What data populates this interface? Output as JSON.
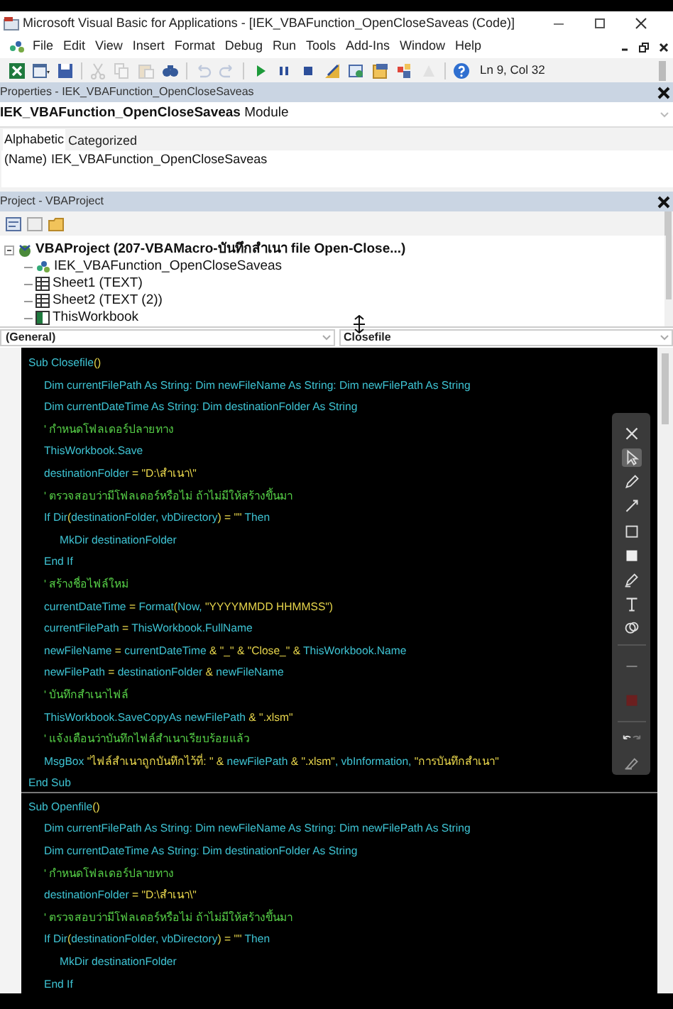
{
  "window": {
    "title": "Microsoft Visual Basic for Applications - [IEK_VBAFunction_OpenCloseSaveas (Code)]"
  },
  "menu": [
    "File",
    "Edit",
    "View",
    "Insert",
    "Format",
    "Debug",
    "Run",
    "Tools",
    "Add-Ins",
    "Window",
    "Help"
  ],
  "toolbar": {
    "buttons": [
      {
        "kind": "excel",
        "disabled": false
      },
      {
        "kind": "insert_form",
        "disabled": false
      },
      {
        "kind": "save",
        "disabled": false
      },
      {
        "kind": "cut",
        "disabled": true
      },
      {
        "kind": "copy",
        "disabled": true
      },
      {
        "kind": "paste",
        "disabled": true
      },
      {
        "kind": "find",
        "disabled": false
      },
      {
        "kind": "undo",
        "disabled": true
      },
      {
        "kind": "redo",
        "disabled": true
      },
      {
        "kind": "run",
        "disabled": false
      },
      {
        "kind": "break",
        "disabled": false
      },
      {
        "kind": "reset",
        "disabled": false
      },
      {
        "kind": "design",
        "disabled": false
      },
      {
        "kind": "project",
        "disabled": false
      },
      {
        "kind": "properties",
        "disabled": false
      },
      {
        "kind": "browser",
        "disabled": false
      },
      {
        "kind": "toolbox",
        "disabled": true
      },
      {
        "kind": "help",
        "disabled": false
      }
    ],
    "position": "Ln 9, Col 32"
  },
  "properties": {
    "title": "Properties - IEK_VBAFunction_OpenCloseSaveas",
    "object": {
      "name": "IEK_VBAFunction_OpenCloseSaveas",
      "type": "Module"
    },
    "tabs": [
      {
        "label": "Alphabetic",
        "selected": true
      },
      {
        "label": "Categorized",
        "selected": false
      }
    ],
    "rows": [
      {
        "name": "(Name)",
        "value": "IEK_VBAFunction_OpenCloseSaveas"
      }
    ]
  },
  "project": {
    "title": "Project - VBAProject",
    "tree": [
      {
        "label": "VBAProject (207-VBAMacro-บันทึกสำเนา file Open-Close...)",
        "kind": "project",
        "expanded": true,
        "children": [
          {
            "label": "IEK_VBAFunction_OpenCloseSaveas",
            "kind": "module"
          },
          {
            "label": "Sheet1 (TEXT)",
            "kind": "sheet"
          },
          {
            "label": "Sheet2 (TEXT (2))",
            "kind": "sheet"
          },
          {
            "label": "ThisWorkbook",
            "kind": "workbook"
          }
        ]
      }
    ]
  },
  "code": {
    "object": "(General)",
    "procedure": "Closefile",
    "procedures": [
      {
        "header": [
          {
            "kind": "code",
            "text": "Sub Closefile"
          },
          {
            "kind": "op",
            "text": "()"
          }
        ],
        "body": [
          {
            "segments": [
              {
                "kind": "code",
                "text": "Dim currentFilePath As String: Dim newFileName As String: Dim newFilePath As String"
              }
            ]
          },
          {
            "segments": [
              {
                "kind": "code",
                "text": "Dim currentDateTime As String: Dim destinationFolder As String"
              }
            ]
          },
          {
            "segments": [
              {
                "kind": "comment",
                "text": "' กำหนดโฟลเดอร์ปลายทาง"
              }
            ]
          },
          {
            "segments": [
              {
                "kind": "code",
                "text": "ThisWorkbook.Save"
              }
            ]
          },
          {
            "segments": [
              {
                "kind": "code",
                "text": "destinationFolder "
              },
              {
                "kind": "op",
                "text": "= "
              },
              {
                "kind": "str",
                "text": "\"D:\\สำเนา\\\""
              }
            ]
          },
          {
            "segments": [
              {
                "kind": "comment",
                "text": "' ตรวจสอบว่ามีโฟลเดอร์หรือไม่ ถ้าไม่มีให้สร้างขึ้นมา"
              }
            ]
          },
          {
            "segments": [
              {
                "kind": "code",
                "text": "If Dir"
              },
              {
                "kind": "op",
                "text": "("
              },
              {
                "kind": "code",
                "text": "destinationFolder, vbDirectory"
              },
              {
                "kind": "op",
                "text": ") = \"\" "
              },
              {
                "kind": "code",
                "text": "Then"
              }
            ],
            "children": [
              {
                "segments": [
                  {
                    "kind": "code",
                    "text": "MkDir destinationFolder"
                  }
                ]
              }
            ]
          },
          {
            "segments": [
              {
                "kind": "code",
                "text": "End If"
              }
            ]
          },
          {
            "segments": [
              {
                "kind": "comment",
                "text": "' สร้างชื่อไฟล์ใหม่"
              }
            ]
          },
          {
            "segments": [
              {
                "kind": "code",
                "text": "currentDateTime "
              },
              {
                "kind": "op",
                "text": "= "
              },
              {
                "kind": "code",
                "text": "Format"
              },
              {
                "kind": "op",
                "text": "("
              },
              {
                "kind": "code",
                "text": "Now, "
              },
              {
                "kind": "str",
                "text": "\"YYYYMMDD HHMMSS\""
              },
              {
                "kind": "op",
                "text": ")"
              }
            ]
          },
          {
            "segments": [
              {
                "kind": "code",
                "text": "currentFilePath "
              },
              {
                "kind": "op",
                "text": "= "
              },
              {
                "kind": "code",
                "text": "ThisWorkbook.FullName"
              }
            ]
          },
          {
            "segments": [
              {
                "kind": "code",
                "text": "newFileName "
              },
              {
                "kind": "op",
                "text": "= "
              },
              {
                "kind": "code",
                "text": "currentDateTime "
              },
              {
                "kind": "op",
                "text": "& "
              },
              {
                "kind": "str",
                "text": "\"_\" "
              },
              {
                "kind": "op",
                "text": "& "
              },
              {
                "kind": "str",
                "text": "\"Close_\" "
              },
              {
                "kind": "op",
                "text": "& "
              },
              {
                "kind": "code",
                "text": "ThisWorkbook.Name"
              }
            ]
          },
          {
            "segments": [
              {
                "kind": "code",
                "text": "newFilePath "
              },
              {
                "kind": "op",
                "text": "= "
              },
              {
                "kind": "code",
                "text": "destinationFolder "
              },
              {
                "kind": "op",
                "text": "& "
              },
              {
                "kind": "code",
                "text": "newFileName"
              }
            ]
          },
          {
            "segments": [
              {
                "kind": "comment",
                "text": "' บันทึกสำเนาไฟล์"
              }
            ]
          },
          {
            "segments": [
              {
                "kind": "code",
                "text": "ThisWorkbook.SaveCopyAs newFilePath "
              },
              {
                "kind": "op",
                "text": "& "
              },
              {
                "kind": "str",
                "text": "\".xlsm\""
              }
            ]
          },
          {
            "segments": [
              {
                "kind": "comment",
                "text": "' แจ้งเตือนว่าบันทึกไฟล์สำเนาเรียบร้อยแล้ว"
              }
            ]
          },
          {
            "segments": [
              {
                "kind": "code",
                "text": "MsgBox "
              },
              {
                "kind": "str",
                "text": "\"ไฟล์สำเนาถูกบันทึกไว้ที่: \" "
              },
              {
                "kind": "op",
                "text": "& "
              },
              {
                "kind": "code",
                "text": "newFilePath "
              },
              {
                "kind": "op",
                "text": "& "
              },
              {
                "kind": "str",
                "text": "\".xlsm\""
              },
              {
                "kind": "code",
                "text": ", vbInformation, "
              },
              {
                "kind": "str",
                "text": "\"การบันทึกสำเนา\""
              }
            ]
          }
        ],
        "footer": [
          {
            "kind": "code",
            "text": "End Sub"
          }
        ]
      },
      {
        "header": [
          {
            "kind": "code",
            "text": "Sub Openfile"
          },
          {
            "kind": "op",
            "text": "()"
          }
        ],
        "body": [
          {
            "segments": [
              {
                "kind": "code",
                "text": "Dim currentFilePath As String: Dim newFileName As String: Dim newFilePath As String"
              }
            ]
          },
          {
            "segments": [
              {
                "kind": "code",
                "text": "Dim currentDateTime As String: Dim destinationFolder As String"
              }
            ]
          },
          {
            "segments": [
              {
                "kind": "comment",
                "text": "' กำหนดโฟลเดอร์ปลายทาง"
              }
            ]
          },
          {
            "segments": [
              {
                "kind": "code",
                "text": "destinationFolder "
              },
              {
                "kind": "op",
                "text": "= "
              },
              {
                "kind": "str",
                "text": "\"D:\\สำเนา\\\""
              }
            ]
          },
          {
            "segments": [
              {
                "kind": "comment",
                "text": "' ตรวจสอบว่ามีโฟลเดอร์หรือไม่ ถ้าไม่มีให้สร้างขึ้นมา"
              }
            ]
          },
          {
            "segments": [
              {
                "kind": "code",
                "text": "If Dir"
              },
              {
                "kind": "op",
                "text": "("
              },
              {
                "kind": "code",
                "text": "destinationFolder, vbDirectory"
              },
              {
                "kind": "op",
                "text": ") = \"\" "
              },
              {
                "kind": "code",
                "text": "Then"
              }
            ],
            "children": [
              {
                "segments": [
                  {
                    "kind": "code",
                    "text": "MkDir destinationFolder"
                  }
                ]
              }
            ]
          },
          {
            "segments": [
              {
                "kind": "code",
                "text": "End If"
              }
            ]
          }
        ]
      }
    ]
  },
  "annotation_toolbar": {
    "tools": [
      {
        "kind": "close",
        "selected": false
      },
      {
        "kind": "select",
        "selected": true
      },
      {
        "kind": "pen",
        "selected": false
      },
      {
        "kind": "arrow",
        "selected": false
      },
      {
        "kind": "rectangle",
        "selected": false
      },
      {
        "kind": "filled_rectangle",
        "selected": false
      },
      {
        "kind": "highlighter",
        "selected": false
      },
      {
        "kind": "text",
        "selected": false
      },
      {
        "kind": "eraser",
        "selected": false
      },
      {
        "kind": "line_width",
        "selected": false
      },
      {
        "kind": "color",
        "selected": false
      },
      {
        "kind": "undo_redo",
        "selected": false
      },
      {
        "kind": "clear",
        "selected": false
      }
    ]
  }
}
